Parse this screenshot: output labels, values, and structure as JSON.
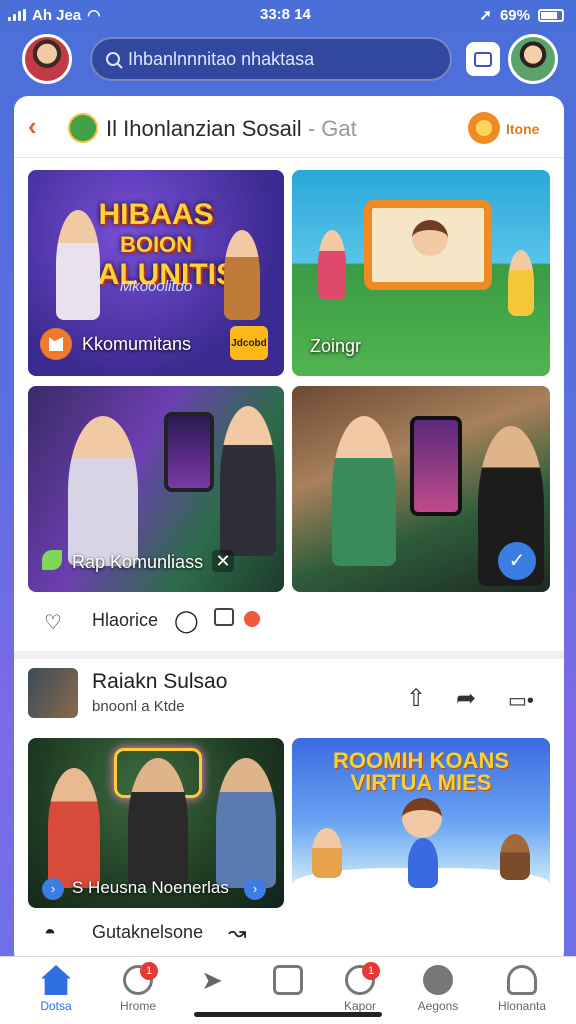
{
  "status_bar": {
    "carrier": "Ah Jea",
    "time": "33:8 14",
    "battery": "69%"
  },
  "search": {
    "placeholder": "Ihbanlnnnitao nhaktasa"
  },
  "header": {
    "back_symbol": "‹",
    "title": "Il Ihonlanzian Sosail",
    "title_suffix": "- Gat",
    "home_label": "Itone"
  },
  "tiles": {
    "t1": {
      "poster_title_line1": "HIBAAS",
      "poster_title_line2": "BOION",
      "poster_title_line3": "HALUNITIS",
      "poster_subtitle": "Mkooolitdo",
      "label": "Kkomumitans",
      "badge": "Jdcobd"
    },
    "t2": {
      "label": "Zoingr"
    },
    "t3": {
      "label": "Rap Komunliass"
    },
    "t4": {
      "label": ""
    },
    "t5": {
      "label": "S Heusna Noenerlas"
    },
    "t6": {
      "title_line1": "ROOMIH KOANS",
      "title_line2": "VIRTUA MIES"
    }
  },
  "actions1": {
    "label": "Hlaorice"
  },
  "post": {
    "title": "Raiakn Sulsao",
    "subtitle": "bnoonl a Ktde"
  },
  "actions2": {
    "label": "Gutaknelsone"
  },
  "bottom_nav": [
    {
      "label": "Dotsa",
      "icon": "home-icon",
      "badge": ""
    },
    {
      "label": "Hrome",
      "icon": "group-icon",
      "badge": "1"
    },
    {
      "label": "",
      "icon": "send-icon",
      "badge": ""
    },
    {
      "label": "",
      "icon": "grid-icon",
      "badge": ""
    },
    {
      "label": "Kapor",
      "icon": "clock-icon",
      "badge": "1"
    },
    {
      "label": "Aegons",
      "icon": "circle-icon",
      "badge": ""
    },
    {
      "label": "Hlonanta",
      "icon": "profile-icon",
      "badge": ""
    }
  ],
  "colors": {
    "accent": "#2f6fe0",
    "orange": "#f07a2a",
    "badge_red": "#e53935"
  }
}
